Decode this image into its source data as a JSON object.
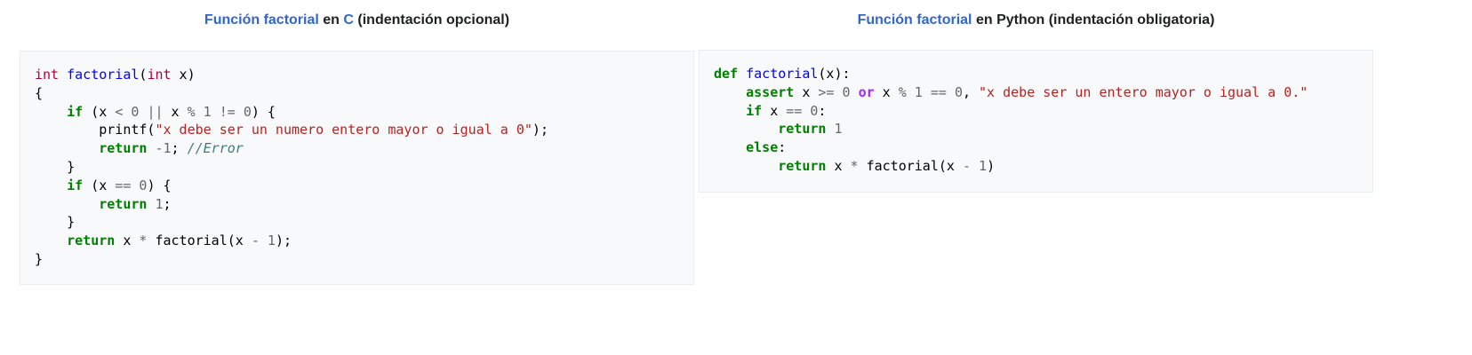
{
  "left": {
    "heading": {
      "link1": "Función factorial",
      "mid": " en ",
      "link2": "C",
      "rest": " (indentación opcional)"
    },
    "code": {
      "t_int1": "int",
      "t_factorial": "factorial",
      "t_int2": "int",
      "t_x_param": " x)",
      "t_brace_open": "{",
      "t_if1": "if",
      "t_cond1_a": " (x ",
      "t_lt": "<",
      "t_zero1": "0",
      "t_or": "||",
      "t_cond1_b": " x ",
      "t_mod": "%",
      "t_one1": "1",
      "t_ne": "!=",
      "t_zero2": "0",
      "t_cond1_c": ") {",
      "t_printf": "printf(",
      "t_str1": "\"x debe ser un numero entero mayor o igual a 0\"",
      "t_printf_end": ");",
      "t_return1": "return",
      "t_neg1": "-1",
      "t_semicolon1": ";",
      "t_comment": "//Error",
      "t_close1": "}",
      "t_if2": "if",
      "t_cond2_a": " (x ",
      "t_eq": "==",
      "t_zero3": "0",
      "t_cond2_b": ") {",
      "t_return2": "return",
      "t_one2": "1",
      "t_semicolon2": ";",
      "t_close2": "}",
      "t_return3": "return",
      "t_expr_a": " x ",
      "t_mul": "*",
      "t_expr_b": " factorial(x ",
      "t_minus": "-",
      "t_one3": "1",
      "t_expr_c": ");",
      "t_brace_close": "}"
    }
  },
  "right": {
    "heading": {
      "link1": "Función factorial",
      "mid": " en Python (indentación obligatoria)"
    },
    "code": {
      "p_def": "def",
      "p_factorial": "factorial",
      "p_params": "(x):",
      "p_assert": "assert",
      "p_a1": " x ",
      "p_ge": ">=",
      "p_zero1": "0",
      "p_or": "or",
      "p_a2": " x ",
      "p_mod": "%",
      "p_one1": "1",
      "p_eq1": "==",
      "p_zero2": "0",
      "p_comma": ", ",
      "p_str": "\"x debe ser un entero mayor o igual a 0.\"",
      "p_if": "if",
      "p_i1": " x ",
      "p_eq2": "==",
      "p_zero3": "0",
      "p_colon1": ":",
      "p_return1": "return",
      "p_one2": "1",
      "p_else": "else",
      "p_colon2": ":",
      "p_return2": "return",
      "p_r1": " x ",
      "p_mul": "*",
      "p_r2": " factorial(x ",
      "p_minus": "-",
      "p_one3": "1",
      "p_r3": ")"
    }
  }
}
